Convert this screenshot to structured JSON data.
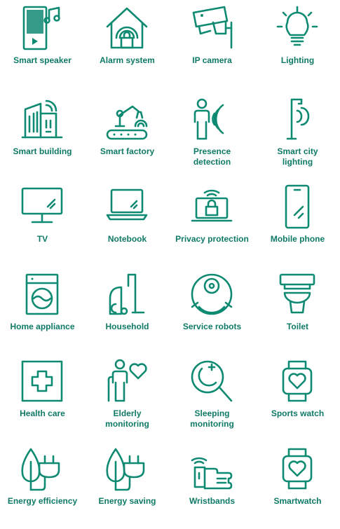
{
  "icons": [
    {
      "label": "Smart speaker",
      "icon": "smart-speaker-icon"
    },
    {
      "label": "Alarm system",
      "icon": "alarm-system-icon"
    },
    {
      "label": "IP camera",
      "icon": "ip-camera-icon"
    },
    {
      "label": "Lighting",
      "icon": "lighting-icon"
    },
    {
      "label": "Smart building",
      "icon": "smart-building-icon"
    },
    {
      "label": "Smart factory",
      "icon": "smart-factory-icon"
    },
    {
      "label": "Presence\ndetection",
      "icon": "presence-detection-icon"
    },
    {
      "label": "Smart city\nlighting",
      "icon": "smart-city-lighting-icon"
    },
    {
      "label": "TV",
      "icon": "tv-icon"
    },
    {
      "label": "Notebook",
      "icon": "notebook-icon"
    },
    {
      "label": "Privacy protection",
      "icon": "privacy-protection-icon"
    },
    {
      "label": "Mobile phone",
      "icon": "mobile-phone-icon"
    },
    {
      "label": "Home appliance",
      "icon": "home-appliance-icon"
    },
    {
      "label": "Household",
      "icon": "household-icon"
    },
    {
      "label": "Service robots",
      "icon": "service-robots-icon"
    },
    {
      "label": "Toilet",
      "icon": "toilet-icon"
    },
    {
      "label": "Health care",
      "icon": "health-care-icon"
    },
    {
      "label": "Elderly\nmonitoring",
      "icon": "elderly-monitoring-icon"
    },
    {
      "label": "Sleeping\nmonitoring",
      "icon": "sleeping-monitoring-icon"
    },
    {
      "label": "Sports watch",
      "icon": "sports-watch-icon"
    },
    {
      "label": "Energy efficiency",
      "icon": "energy-efficiency-icon"
    },
    {
      "label": "Energy saving",
      "icon": "energy-saving-icon"
    },
    {
      "label": "Wristbands",
      "icon": "wristbands-icon"
    },
    {
      "label": "Smartwatch",
      "icon": "smartwatch-icon"
    }
  ],
  "colors": {
    "icon": "#0f8a72",
    "label": "#0f7a67",
    "background": "#ffffff"
  }
}
